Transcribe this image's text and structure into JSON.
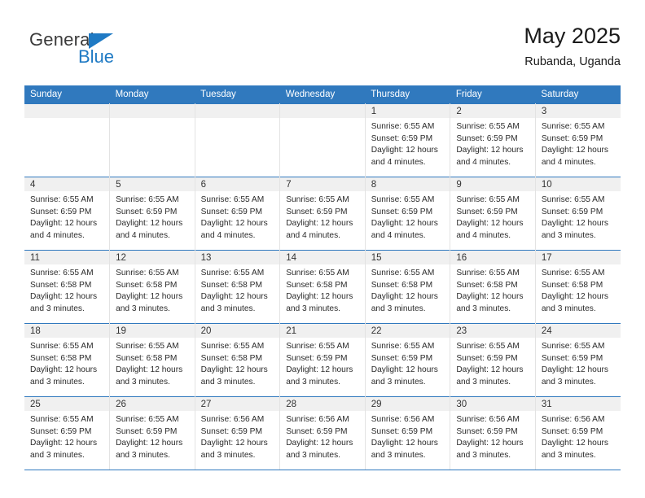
{
  "brand": {
    "name_part1": "General",
    "name_part2": "Blue",
    "triangle_icon": "triangle-icon",
    "accent_color": "#1f7ac4",
    "text_color": "#3b3b3b"
  },
  "header": {
    "title": "May 2025",
    "subtitle": "Rubanda, Uganda",
    "header_bg_color": "#3079be",
    "header_text_color": "#ffffff"
  },
  "weekday_headers": [
    "Sunday",
    "Monday",
    "Tuesday",
    "Wednesday",
    "Thursday",
    "Friday",
    "Saturday"
  ],
  "weeks": [
    [
      {
        "day": "",
        "sunrise": "",
        "sunset": "",
        "daylight_1": "",
        "daylight_2": "",
        "empty": true
      },
      {
        "day": "",
        "sunrise": "",
        "sunset": "",
        "daylight_1": "",
        "daylight_2": "",
        "empty": true
      },
      {
        "day": "",
        "sunrise": "",
        "sunset": "",
        "daylight_1": "",
        "daylight_2": "",
        "empty": true
      },
      {
        "day": "",
        "sunrise": "",
        "sunset": "",
        "daylight_1": "",
        "daylight_2": "",
        "empty": true
      },
      {
        "day": "1",
        "sunrise": "Sunrise: 6:55 AM",
        "sunset": "Sunset: 6:59 PM",
        "daylight_1": "Daylight: 12 hours",
        "daylight_2": "and 4 minutes.",
        "empty": false
      },
      {
        "day": "2",
        "sunrise": "Sunrise: 6:55 AM",
        "sunset": "Sunset: 6:59 PM",
        "daylight_1": "Daylight: 12 hours",
        "daylight_2": "and 4 minutes.",
        "empty": false
      },
      {
        "day": "3",
        "sunrise": "Sunrise: 6:55 AM",
        "sunset": "Sunset: 6:59 PM",
        "daylight_1": "Daylight: 12 hours",
        "daylight_2": "and 4 minutes.",
        "empty": false
      }
    ],
    [
      {
        "day": "4",
        "sunrise": "Sunrise: 6:55 AM",
        "sunset": "Sunset: 6:59 PM",
        "daylight_1": "Daylight: 12 hours",
        "daylight_2": "and 4 minutes.",
        "empty": false
      },
      {
        "day": "5",
        "sunrise": "Sunrise: 6:55 AM",
        "sunset": "Sunset: 6:59 PM",
        "daylight_1": "Daylight: 12 hours",
        "daylight_2": "and 4 minutes.",
        "empty": false
      },
      {
        "day": "6",
        "sunrise": "Sunrise: 6:55 AM",
        "sunset": "Sunset: 6:59 PM",
        "daylight_1": "Daylight: 12 hours",
        "daylight_2": "and 4 minutes.",
        "empty": false
      },
      {
        "day": "7",
        "sunrise": "Sunrise: 6:55 AM",
        "sunset": "Sunset: 6:59 PM",
        "daylight_1": "Daylight: 12 hours",
        "daylight_2": "and 4 minutes.",
        "empty": false
      },
      {
        "day": "8",
        "sunrise": "Sunrise: 6:55 AM",
        "sunset": "Sunset: 6:59 PM",
        "daylight_1": "Daylight: 12 hours",
        "daylight_2": "and 4 minutes.",
        "empty": false
      },
      {
        "day": "9",
        "sunrise": "Sunrise: 6:55 AM",
        "sunset": "Sunset: 6:59 PM",
        "daylight_1": "Daylight: 12 hours",
        "daylight_2": "and 4 minutes.",
        "empty": false
      },
      {
        "day": "10",
        "sunrise": "Sunrise: 6:55 AM",
        "sunset": "Sunset: 6:59 PM",
        "daylight_1": "Daylight: 12 hours",
        "daylight_2": "and 3 minutes.",
        "empty": false
      }
    ],
    [
      {
        "day": "11",
        "sunrise": "Sunrise: 6:55 AM",
        "sunset": "Sunset: 6:58 PM",
        "daylight_1": "Daylight: 12 hours",
        "daylight_2": "and 3 minutes.",
        "empty": false
      },
      {
        "day": "12",
        "sunrise": "Sunrise: 6:55 AM",
        "sunset": "Sunset: 6:58 PM",
        "daylight_1": "Daylight: 12 hours",
        "daylight_2": "and 3 minutes.",
        "empty": false
      },
      {
        "day": "13",
        "sunrise": "Sunrise: 6:55 AM",
        "sunset": "Sunset: 6:58 PM",
        "daylight_1": "Daylight: 12 hours",
        "daylight_2": "and 3 minutes.",
        "empty": false
      },
      {
        "day": "14",
        "sunrise": "Sunrise: 6:55 AM",
        "sunset": "Sunset: 6:58 PM",
        "daylight_1": "Daylight: 12 hours",
        "daylight_2": "and 3 minutes.",
        "empty": false
      },
      {
        "day": "15",
        "sunrise": "Sunrise: 6:55 AM",
        "sunset": "Sunset: 6:58 PM",
        "daylight_1": "Daylight: 12 hours",
        "daylight_2": "and 3 minutes.",
        "empty": false
      },
      {
        "day": "16",
        "sunrise": "Sunrise: 6:55 AM",
        "sunset": "Sunset: 6:58 PM",
        "daylight_1": "Daylight: 12 hours",
        "daylight_2": "and 3 minutes.",
        "empty": false
      },
      {
        "day": "17",
        "sunrise": "Sunrise: 6:55 AM",
        "sunset": "Sunset: 6:58 PM",
        "daylight_1": "Daylight: 12 hours",
        "daylight_2": "and 3 minutes.",
        "empty": false
      }
    ],
    [
      {
        "day": "18",
        "sunrise": "Sunrise: 6:55 AM",
        "sunset": "Sunset: 6:58 PM",
        "daylight_1": "Daylight: 12 hours",
        "daylight_2": "and 3 minutes.",
        "empty": false
      },
      {
        "day": "19",
        "sunrise": "Sunrise: 6:55 AM",
        "sunset": "Sunset: 6:58 PM",
        "daylight_1": "Daylight: 12 hours",
        "daylight_2": "and 3 minutes.",
        "empty": false
      },
      {
        "day": "20",
        "sunrise": "Sunrise: 6:55 AM",
        "sunset": "Sunset: 6:58 PM",
        "daylight_1": "Daylight: 12 hours",
        "daylight_2": "and 3 minutes.",
        "empty": false
      },
      {
        "day": "21",
        "sunrise": "Sunrise: 6:55 AM",
        "sunset": "Sunset: 6:59 PM",
        "daylight_1": "Daylight: 12 hours",
        "daylight_2": "and 3 minutes.",
        "empty": false
      },
      {
        "day": "22",
        "sunrise": "Sunrise: 6:55 AM",
        "sunset": "Sunset: 6:59 PM",
        "daylight_1": "Daylight: 12 hours",
        "daylight_2": "and 3 minutes.",
        "empty": false
      },
      {
        "day": "23",
        "sunrise": "Sunrise: 6:55 AM",
        "sunset": "Sunset: 6:59 PM",
        "daylight_1": "Daylight: 12 hours",
        "daylight_2": "and 3 minutes.",
        "empty": false
      },
      {
        "day": "24",
        "sunrise": "Sunrise: 6:55 AM",
        "sunset": "Sunset: 6:59 PM",
        "daylight_1": "Daylight: 12 hours",
        "daylight_2": "and 3 minutes.",
        "empty": false
      }
    ],
    [
      {
        "day": "25",
        "sunrise": "Sunrise: 6:55 AM",
        "sunset": "Sunset: 6:59 PM",
        "daylight_1": "Daylight: 12 hours",
        "daylight_2": "and 3 minutes.",
        "empty": false
      },
      {
        "day": "26",
        "sunrise": "Sunrise: 6:55 AM",
        "sunset": "Sunset: 6:59 PM",
        "daylight_1": "Daylight: 12 hours",
        "daylight_2": "and 3 minutes.",
        "empty": false
      },
      {
        "day": "27",
        "sunrise": "Sunrise: 6:56 AM",
        "sunset": "Sunset: 6:59 PM",
        "daylight_1": "Daylight: 12 hours",
        "daylight_2": "and 3 minutes.",
        "empty": false
      },
      {
        "day": "28",
        "sunrise": "Sunrise: 6:56 AM",
        "sunset": "Sunset: 6:59 PM",
        "daylight_1": "Daylight: 12 hours",
        "daylight_2": "and 3 minutes.",
        "empty": false
      },
      {
        "day": "29",
        "sunrise": "Sunrise: 6:56 AM",
        "sunset": "Sunset: 6:59 PM",
        "daylight_1": "Daylight: 12 hours",
        "daylight_2": "and 3 minutes.",
        "empty": false
      },
      {
        "day": "30",
        "sunrise": "Sunrise: 6:56 AM",
        "sunset": "Sunset: 6:59 PM",
        "daylight_1": "Daylight: 12 hours",
        "daylight_2": "and 3 minutes.",
        "empty": false
      },
      {
        "day": "31",
        "sunrise": "Sunrise: 6:56 AM",
        "sunset": "Sunset: 6:59 PM",
        "daylight_1": "Daylight: 12 hours",
        "daylight_2": "and 3 minutes.",
        "empty": false
      }
    ]
  ]
}
